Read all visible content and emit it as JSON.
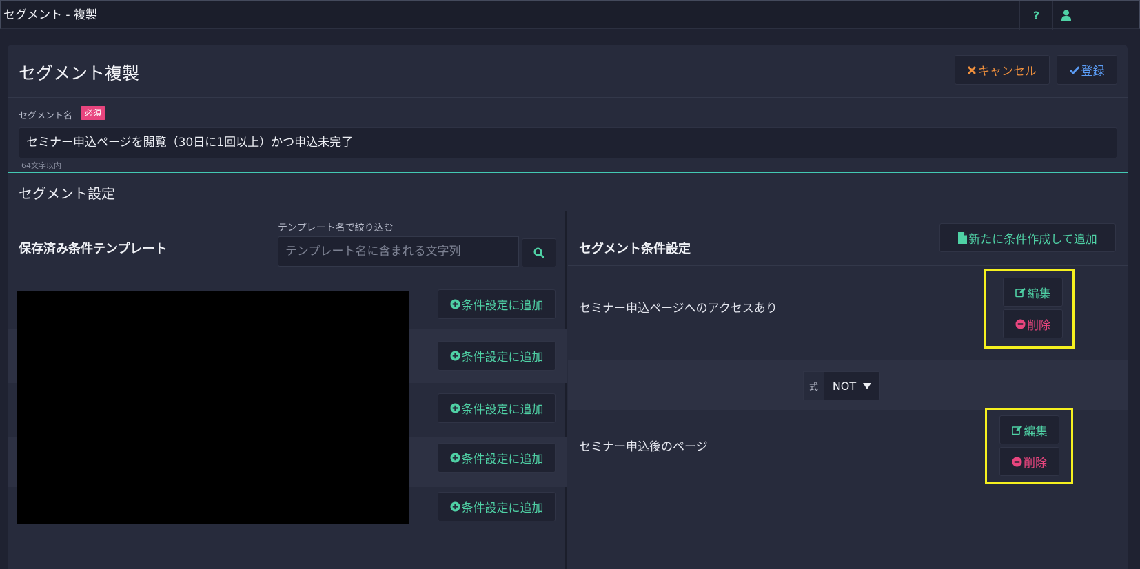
{
  "window": {
    "title": "セグメント - 複製",
    "help_icon": "question-icon",
    "user_icon": "user-icon",
    "help_label": "?"
  },
  "header": {
    "title": "セグメント複製",
    "cancel_label": "キャンセル",
    "save_label": "登録"
  },
  "segment_name": {
    "label": "セグメント名",
    "required_badge": "必須",
    "value": "セミナー申込ページを閲覧（30日に1回以上）かつ申込未完了",
    "hint": "64文字以内"
  },
  "segment_settings": {
    "title": "セグメント設定"
  },
  "templates": {
    "title": "保存済み条件テンプレート",
    "filter_label": "テンプレート名で絞り込む",
    "filter_placeholder": "テンプレート名に含まれる文字列",
    "add_label": "条件設定に追加",
    "rows": [
      {
        "add_label": "条件設定に追加"
      },
      {
        "add_label": "条件設定に追加"
      },
      {
        "add_label": "条件設定に追加"
      },
      {
        "add_label": "条件設定に追加"
      },
      {
        "add_label": "条件設定に追加"
      }
    ]
  },
  "conditions": {
    "title": "セグメント条件設定",
    "new_label": "新たに条件作成して追加",
    "items": [
      {
        "text": "セミナー申込ページへのアクセスあり",
        "edit_label": "編集",
        "delete_label": "削除"
      },
      {
        "text": "セミナー申込後のページ",
        "edit_label": "編集",
        "delete_label": "削除"
      }
    ],
    "expression": {
      "label": "式",
      "value": "NOT"
    }
  },
  "colors": {
    "accent_teal": "#4fd1a5",
    "cancel_orange": "#f0903d",
    "save_blue": "#5b9cf5",
    "danger_pink": "#e8457e",
    "highlight_yellow": "#f5f01f"
  }
}
